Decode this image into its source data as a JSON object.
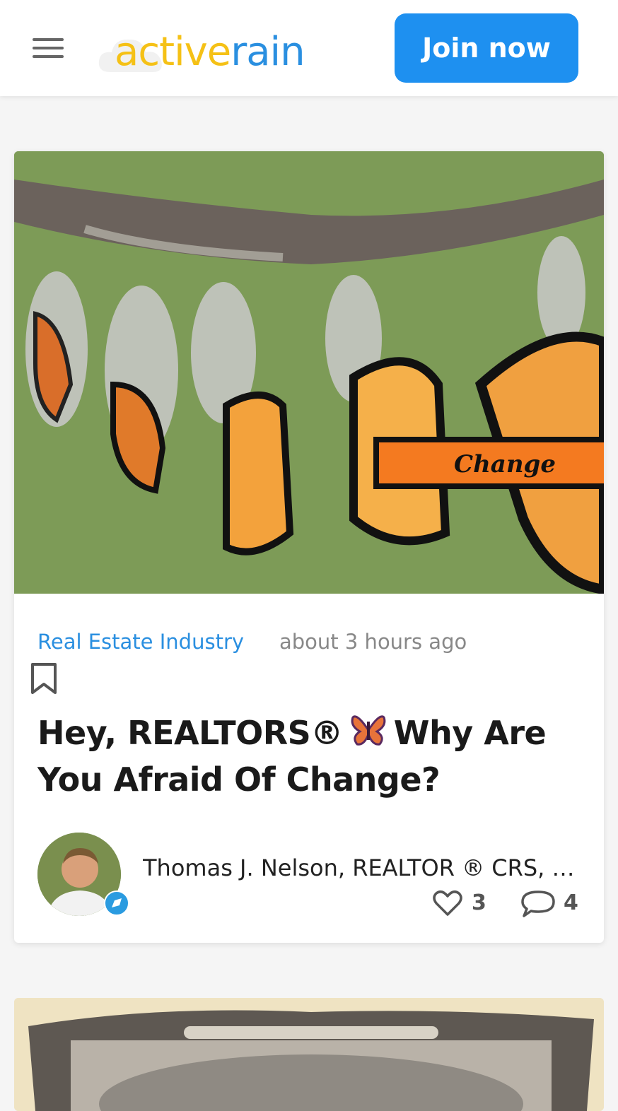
{
  "header": {
    "logo_active": "active",
    "logo_rain": "rain",
    "join_label": "Join now"
  },
  "post": {
    "category": "Real Estate Industry",
    "time": "about 3 hours ago",
    "title_part1": "Hey, REALTORS®",
    "title_part2": "Why Are You Afraid Of Change?",
    "hero_caption": "Change",
    "author": "Thomas J. Nelson, REALTOR ® CRS, SRES",
    "likes": "3",
    "comments": "4"
  },
  "colors": {
    "accent_blue": "#1e90f0",
    "logo_yellow": "#f5c116",
    "link_blue": "#2a8fe0"
  }
}
